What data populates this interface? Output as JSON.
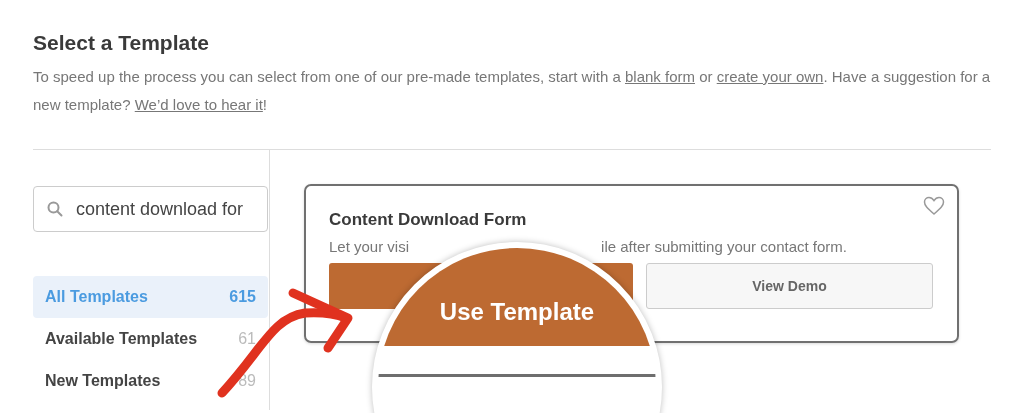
{
  "header": {
    "title": "Select a Template",
    "intro": [
      {
        "kind": "text",
        "text": "To speed up the process you can select from one of our pre-made templates, start with a "
      },
      {
        "kind": "link",
        "text": "blank form"
      },
      {
        "kind": "text",
        "text": " or "
      },
      {
        "kind": "link",
        "text": "create your own"
      },
      {
        "kind": "text",
        "text": ". Have a suggestion for a new template? "
      },
      {
        "kind": "link",
        "text": "We’d love to hear it"
      },
      {
        "kind": "text",
        "text": "!"
      }
    ]
  },
  "search": {
    "value": "content download for"
  },
  "categories": [
    {
      "label": "All Templates",
      "count": "615",
      "selected": true
    },
    {
      "label": "Available Templates",
      "count": "61",
      "selected": false
    },
    {
      "label": "New Templates",
      "count": "89",
      "selected": false
    }
  ],
  "template": {
    "title": "Content Download Form",
    "description_start": "Let your visi",
    "description_end": "ile after submitting your contact form.",
    "favorite": false,
    "secondary_button": "View Demo"
  },
  "magnifier": {
    "button_label": "Use Template"
  }
}
